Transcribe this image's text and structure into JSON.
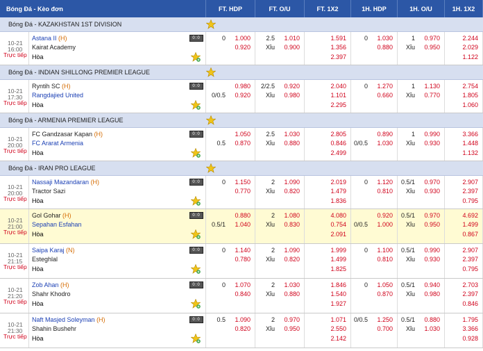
{
  "headers": [
    "Bóng Đá - Kèo đơn",
    "FT. HDP",
    "FT. O/U",
    "FT. 1X2",
    "1H. HDP",
    "1H. O/U",
    "1H. 1X2"
  ],
  "rows": [
    {
      "type": "league",
      "name": "Bóng Đá - KAZAKHSTAN 1ST DIVISION"
    },
    {
      "type": "match",
      "date": "10-21",
      "time": "16:00",
      "live": "Trực tiếp",
      "home": "Astana II",
      "home_tag": "(H)",
      "home_color": "blue",
      "away": "Kairat Academy",
      "away_color": "dark",
      "draw": "Hòa",
      "ft_hdp": {
        "line1": "0",
        "o1": "1.000",
        "line2": "",
        "o2": "0.920"
      },
      "ft_ou": {
        "line1": "2.5",
        "o1": "1.010",
        "line2": "Xỉu",
        "o2": "0.900"
      },
      "ft_1x2": [
        "1.591",
        "1.356",
        "2.397"
      ],
      "h1_hdp": {
        "line1": "0",
        "o1": "1.030",
        "line2": "",
        "o2": "0.880"
      },
      "h1_ou": {
        "line1": "1",
        "o1": "0.970",
        "line2": "Xỉu",
        "o2": "0.950"
      },
      "h1_1x2": [
        "2.244",
        "2.029",
        "1.122"
      ]
    },
    {
      "type": "league",
      "name": "Bóng Đá - INDIAN SHILLONG PREMIER LEAGUE"
    },
    {
      "type": "match",
      "date": "10-21",
      "time": "17:30",
      "live": "Trực tiếp",
      "home": "Ryntih SC",
      "home_tag": "(H)",
      "home_color": "dark",
      "away": "Rangdajied United",
      "away_color": "blue",
      "draw": "Hòa",
      "ft_hdp": {
        "line1": "",
        "o1": "0.980",
        "line2": "0/0.5",
        "o2": "0.920"
      },
      "ft_ou": {
        "line1": "2/2.5",
        "o1": "0.920",
        "line2": "Xỉu",
        "o2": "0.980"
      },
      "ft_1x2": [
        "2.040",
        "1.101",
        "2.295"
      ],
      "h1_hdp": {
        "line1": "0",
        "o1": "1.270",
        "line2": "",
        "o2": "0.660"
      },
      "h1_ou": {
        "line1": "1",
        "o1": "1.130",
        "line2": "Xỉu",
        "o2": "0.770"
      },
      "h1_1x2": [
        "2.754",
        "1.805",
        "1.060"
      ]
    },
    {
      "type": "league",
      "name": "Bóng Đá - ARMENIA PREMIER LEAGUE"
    },
    {
      "type": "match",
      "date": "10-21",
      "time": "20:00",
      "live": "Trực tiếp",
      "home": "FC Gandzasar Kapan",
      "home_tag": "(H)",
      "home_color": "dark",
      "away": "FC Ararat Armenia",
      "away_color": "blue",
      "draw": "Hòa",
      "ft_hdp": {
        "line1": "",
        "o1": "1.050",
        "line2": "0.5",
        "o2": "0.870"
      },
      "ft_ou": {
        "line1": "2.5",
        "o1": "1.030",
        "line2": "Xỉu",
        "o2": "0.880"
      },
      "ft_1x2": [
        "2.805",
        "0.846",
        "2.499"
      ],
      "h1_hdp": {
        "line1": "",
        "o1": "0.890",
        "line2": "0/0.5",
        "o2": "1.030"
      },
      "h1_ou": {
        "line1": "1",
        "o1": "0.990",
        "line2": "Xỉu",
        "o2": "0.930"
      },
      "h1_1x2": [
        "3.366",
        "1.448",
        "1.132"
      ]
    },
    {
      "type": "league",
      "name": "Bóng Đá - IRAN PRO LEAGUE"
    },
    {
      "type": "match",
      "date": "10-21",
      "time": "20:00",
      "live": "Trực tiếp",
      "home": "Nassaji Mazandaran",
      "home_tag": "(H)",
      "home_color": "blue",
      "away": "Tractor Sazi",
      "away_color": "dark",
      "draw": "Hòa",
      "ft_hdp": {
        "line1": "0",
        "o1": "1.150",
        "line2": "",
        "o2": "0.770"
      },
      "ft_ou": {
        "line1": "2",
        "o1": "1.090",
        "line2": "Xỉu",
        "o2": "0.820"
      },
      "ft_1x2": [
        "2.019",
        "1.479",
        "1.836"
      ],
      "h1_hdp": {
        "line1": "0",
        "o1": "1.120",
        "line2": "",
        "o2": "0.810"
      },
      "h1_ou": {
        "line1": "0.5/1",
        "o1": "0.970",
        "line2": "Xỉu",
        "o2": "0.930"
      },
      "h1_1x2": [
        "2.907",
        "2.397",
        "0.795"
      ]
    },
    {
      "type": "match",
      "highlight": true,
      "date": "10-21",
      "time": "21:00",
      "live": "Trực tiếp",
      "home": "Gol Gohar",
      "home_tag": "(H)",
      "home_color": "dark",
      "away": "Sepahan Esfahan",
      "away_color": "blue",
      "draw": "Hòa",
      "ft_hdp": {
        "line1": "",
        "o1": "0.880",
        "line2": "0.5/1",
        "o2": "1.040"
      },
      "ft_ou": {
        "line1": "2",
        "o1": "1.080",
        "line2": "Xỉu",
        "o2": "0.830"
      },
      "ft_1x2": [
        "4.080",
        "0.754",
        "2.091"
      ],
      "h1_hdp": {
        "line1": "",
        "o1": "0.920",
        "line2": "0/0.5",
        "o2": "1.000"
      },
      "h1_ou": {
        "line1": "0.5/1",
        "o1": "0.970",
        "line2": "Xỉu",
        "o2": "0.950"
      },
      "h1_1x2": [
        "4.692",
        "1.499",
        "0.867"
      ]
    },
    {
      "type": "match",
      "date": "10-21",
      "time": "21:15",
      "live": "Trực tiếp",
      "home": "Saipa Karaj",
      "home_tag": "(N)",
      "home_color": "blue",
      "away": "Esteghlal",
      "away_color": "dark",
      "draw": "Hòa",
      "ft_hdp": {
        "line1": "0",
        "o1": "1.140",
        "line2": "",
        "o2": "0.780"
      },
      "ft_ou": {
        "line1": "2",
        "o1": "1.090",
        "line2": "Xỉu",
        "o2": "0.820"
      },
      "ft_1x2": [
        "1.999",
        "1.499",
        "1.825"
      ],
      "h1_hdp": {
        "line1": "0",
        "o1": "1.100",
        "line2": "",
        "o2": "0.810"
      },
      "h1_ou": {
        "line1": "0.5/1",
        "o1": "0.990",
        "line2": "Xỉu",
        "o2": "0.930"
      },
      "h1_1x2": [
        "2.907",
        "2.397",
        "0.795"
      ]
    },
    {
      "type": "match",
      "date": "10-21",
      "time": "21:20",
      "live": "Trực tiếp",
      "home": "Zob Ahan",
      "home_tag": "(H)",
      "home_color": "blue",
      "away": "Shahr Khodro",
      "away_color": "dark",
      "draw": "Hòa",
      "ft_hdp": {
        "line1": "0",
        "o1": "1.070",
        "line2": "",
        "o2": "0.840"
      },
      "ft_ou": {
        "line1": "2",
        "o1": "1.030",
        "line2": "Xỉu",
        "o2": "0.880"
      },
      "ft_1x2": [
        "1.846",
        "1.540",
        "1.927"
      ],
      "h1_hdp": {
        "line1": "0",
        "o1": "1.050",
        "line2": "",
        "o2": "0.870"
      },
      "h1_ou": {
        "line1": "0.5/1",
        "o1": "0.940",
        "line2": "Xỉu",
        "o2": "0.980"
      },
      "h1_1x2": [
        "2.703",
        "2.397",
        "0.846"
      ]
    },
    {
      "type": "match",
      "date": "10-21",
      "time": "21:30",
      "live": "Trực tiếp",
      "home": "Naft Masjed Soleyman",
      "home_tag": "(H)",
      "home_color": "blue",
      "away": "Shahin Bushehr",
      "away_color": "dark",
      "draw": "Hòa",
      "ft_hdp": {
        "line1": "0.5",
        "o1": "1.090",
        "line2": "",
        "o2": "0.820"
      },
      "ft_ou": {
        "line1": "2",
        "o1": "0.970",
        "line2": "Xỉu",
        "o2": "0.950"
      },
      "ft_1x2": [
        "1.071",
        "2.550",
        "2.142"
      ],
      "h1_hdp": {
        "line1": "0/0.5",
        "o1": "1.250",
        "line2": "",
        "o2": "0.700"
      },
      "h1_ou": {
        "line1": "0.5/1",
        "o1": "0.880",
        "line2": "Xỉu",
        "o2": "1.030"
      },
      "h1_1x2": [
        "1.795",
        "3.366",
        "0.928"
      ]
    }
  ],
  "colors": {
    "header_bg": "#2c57a6",
    "league_bg": "#d7dff0",
    "odds_red": "#d0021b",
    "team_blue": "#1a3fb4",
    "highlight": "#fffbd3"
  }
}
